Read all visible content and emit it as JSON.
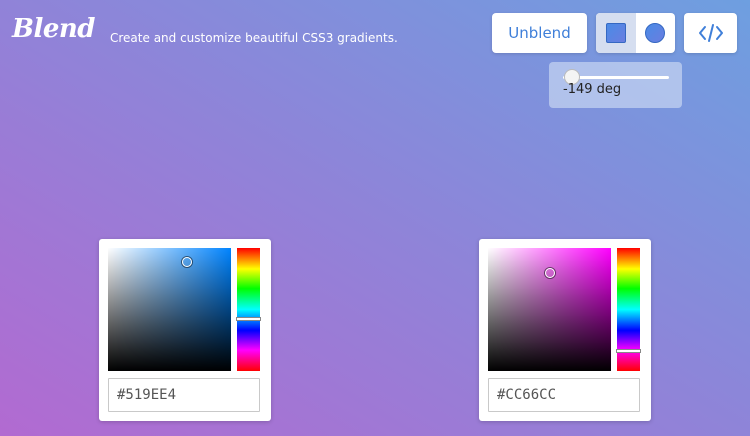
{
  "header": {
    "logo": "Blend",
    "tagline": "Create and customize beautiful CSS3 gradients."
  },
  "toolbar": {
    "unblend_label": "Unblend",
    "shape_options": [
      "square-icon",
      "circle-icon"
    ],
    "shape_selected": "square",
    "code_icon": "code-icon"
  },
  "angle": {
    "value": -149,
    "min": -180,
    "max": 180,
    "label": "-149 deg"
  },
  "pickers": [
    {
      "hex": "#519EE4",
      "hue": 209,
      "saturation": 0.64,
      "brightness": 0.89
    },
    {
      "hex": "#CC66CC",
      "hue": 300,
      "saturation": 0.5,
      "brightness": 0.8
    }
  ],
  "colors": {
    "accent": "#3F7FD9",
    "color_1": "#519EE4",
    "color_2": "#CC66CC"
  }
}
